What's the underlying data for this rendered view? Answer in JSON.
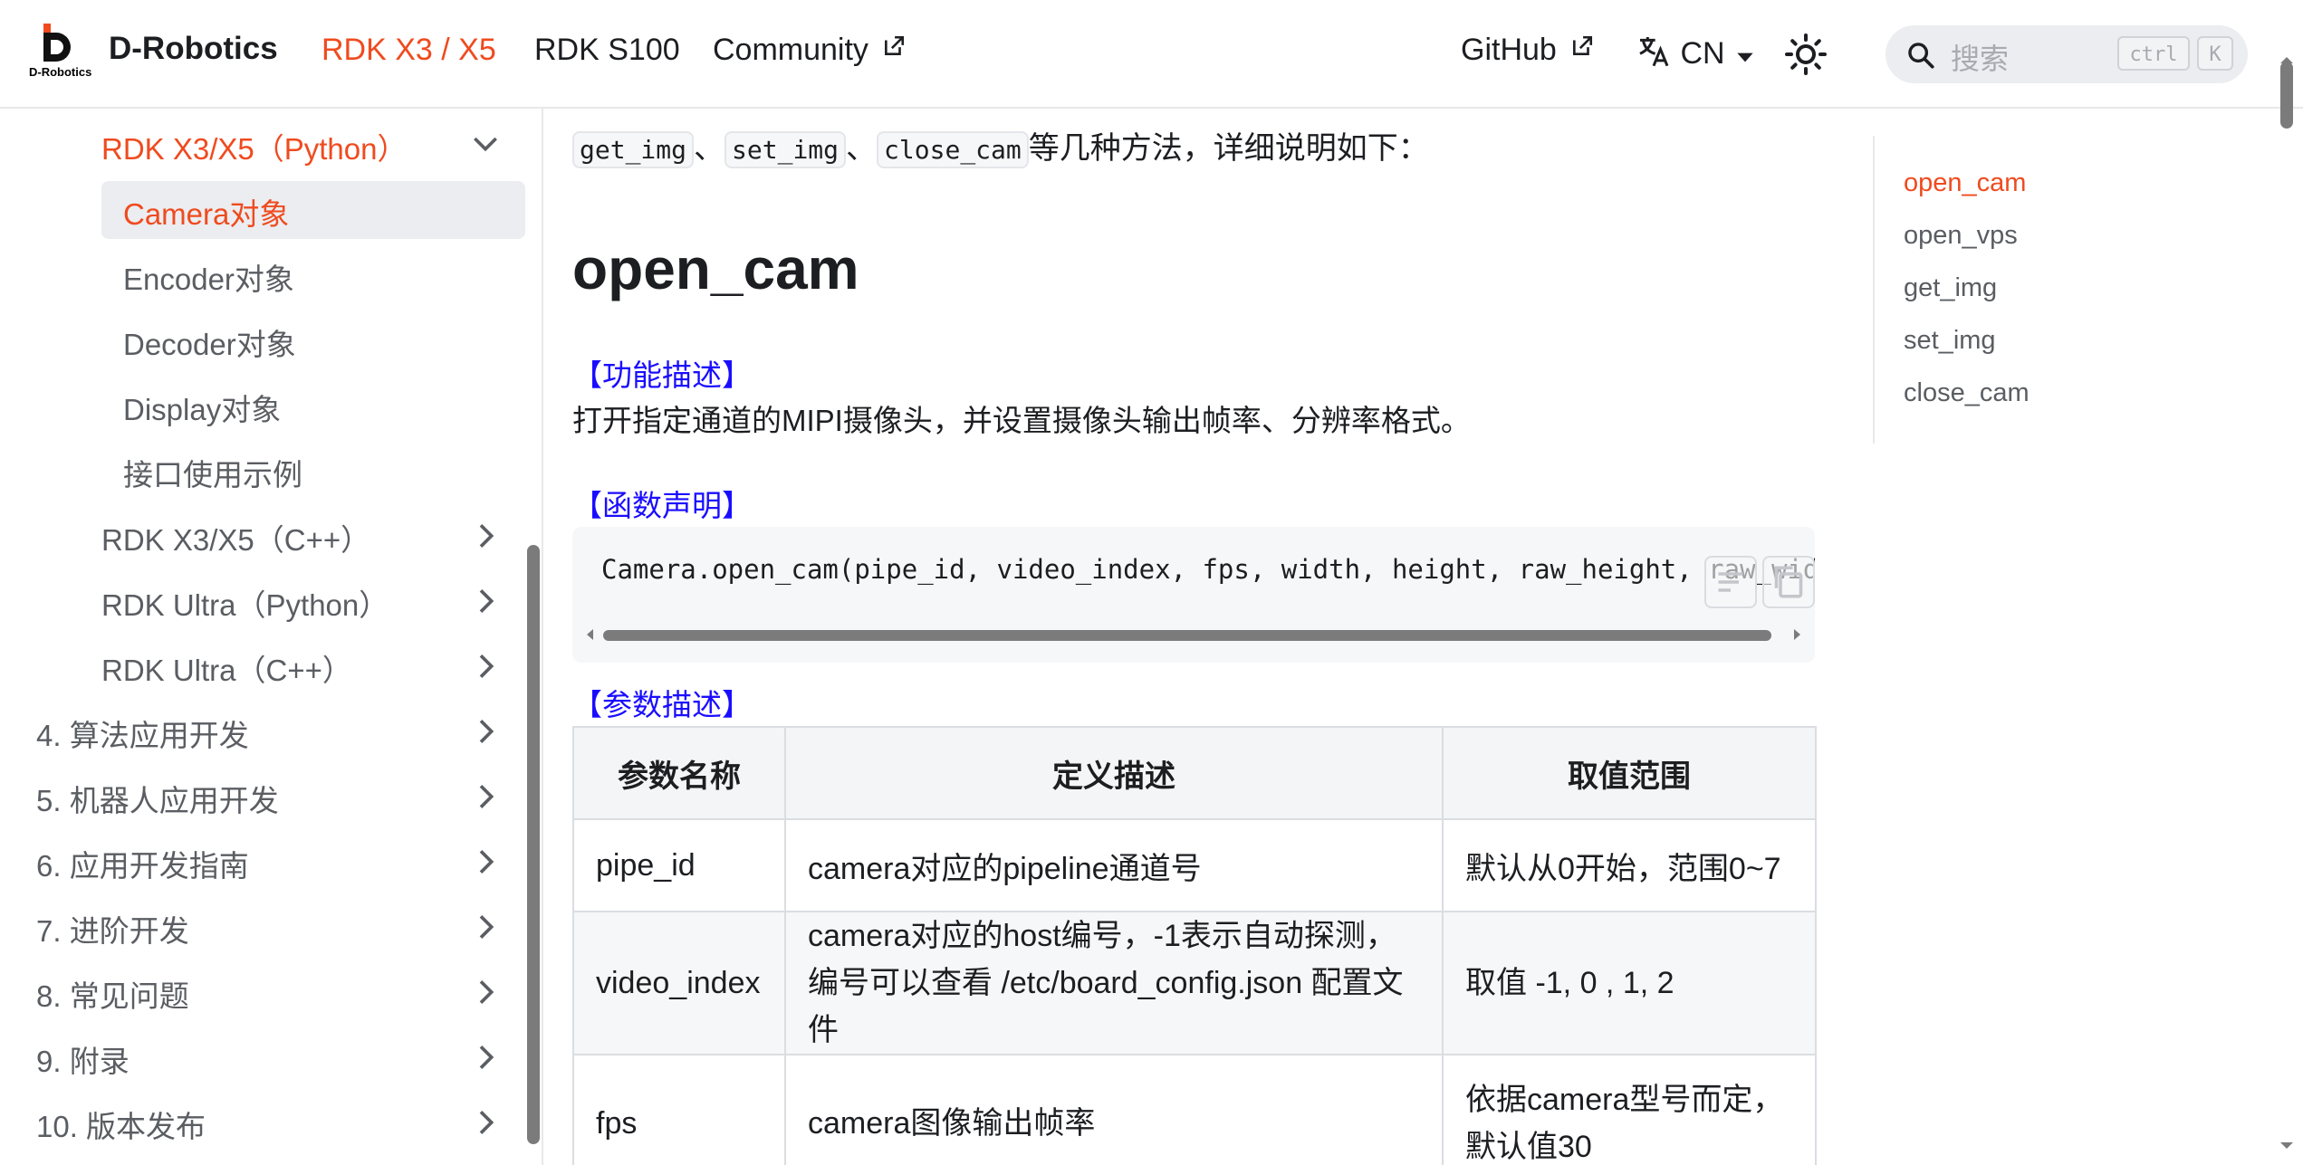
{
  "navbar": {
    "logo_text": "D-Robotics",
    "brand": "D-Robotics",
    "links": [
      "RDK X3 / X5",
      "RDK S100",
      "Community"
    ],
    "github": "GitHub",
    "language": "CN",
    "search_placeholder": "搜索",
    "kbd_ctrl": "ctrl",
    "kbd_k": "K",
    "accent_color": "#ef4b1f"
  },
  "sidebar": {
    "items": [
      "RDK X3/X5（Python）",
      "Camera对象",
      "Encoder对象",
      "Decoder对象",
      "Display对象",
      "接口使用示例",
      "RDK X3/X5（C++）",
      "RDK Ultra（Python）",
      "RDK Ultra（C++）",
      "4. 算法应用开发",
      "5. 机器人应用开发",
      "6. 应用开发指南",
      "7. 进阶开发",
      "8. 常见问题",
      "9. 附录",
      "10. 版本发布"
    ]
  },
  "main": {
    "intro_methods": [
      "get_img",
      "set_img",
      "close_cam"
    ],
    "intro_sep": "、",
    "intro_tail": "等几种方法，详细说明如下：",
    "heading": "open_cam",
    "func_desc_label": "【功能描述】",
    "func_desc_text": "打开指定通道的MIPI摄像头，并设置摄像头输出帧率、分辨率格式。",
    "func_decl_label": "【函数声明】",
    "code": "Camera.open_cam(pipe_id, video_index, fps, width, height, raw_height, raw_width)",
    "param_desc_label": "【参数描述】",
    "table": {
      "headers": [
        "参数名称",
        "定义描述",
        "取值范围"
      ],
      "rows": [
        [
          "pipe_id",
          "camera对应的pipeline通道号",
          "默认从0开始，范围0~7"
        ],
        [
          "video_index",
          "camera对应的host编号，-1表示自动探测，编号可以查看 /etc/board_config.json 配置文件",
          "取值 -1, 0 , 1, 2"
        ],
        [
          "fps",
          "camera图像输出帧率",
          "依据camera型号而定，默认值30"
        ]
      ]
    }
  },
  "toc": {
    "items": [
      "open_cam",
      "open_vps",
      "get_img",
      "set_img",
      "close_cam"
    ]
  }
}
